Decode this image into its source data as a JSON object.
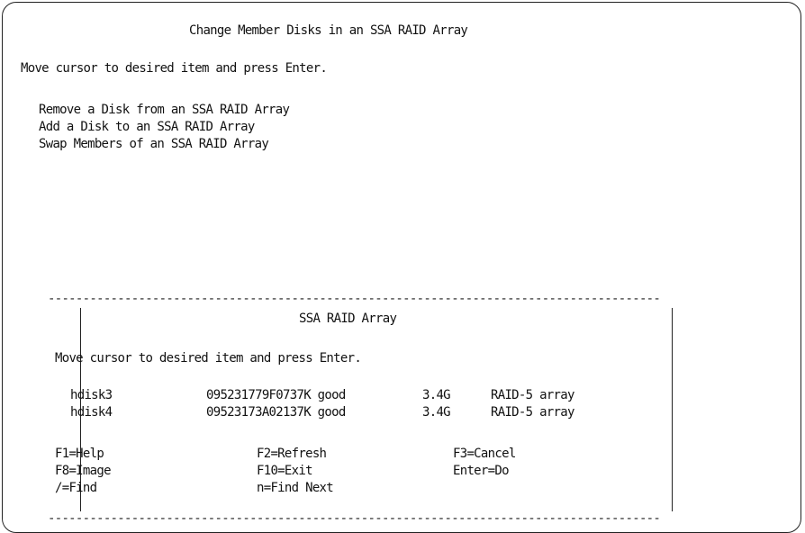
{
  "screen": {
    "title": "Change Member Disks in an SSA RAID Array",
    "instruction": "Move cursor to desired item and press Enter.",
    "menu_items": [
      "Remove a Disk from an SSA RAID Array",
      "Add a Disk to an SSA RAID Array",
      "Swap Members of an SSA RAID Array"
    ]
  },
  "popup": {
    "title": "SSA RAID Array",
    "instruction": "Move cursor to desired item and press Enter.",
    "rows": [
      {
        "name": "hdisk3",
        "id": "095231779F0737K good",
        "size": "3.4G",
        "type": "RAID-5 array"
      },
      {
        "name": "hdisk4",
        "id": "09523173A02137K good",
        "size": "3.4G",
        "type": "RAID-5 array"
      }
    ],
    "function_keys": [
      [
        "F1=Help",
        "F2=Refresh",
        "F3=Cancel"
      ],
      [
        "F8=Image",
        "F10=Exit",
        "Enter=Do"
      ],
      [
        "/=Find",
        "n=Find Next",
        ""
      ]
    ]
  }
}
